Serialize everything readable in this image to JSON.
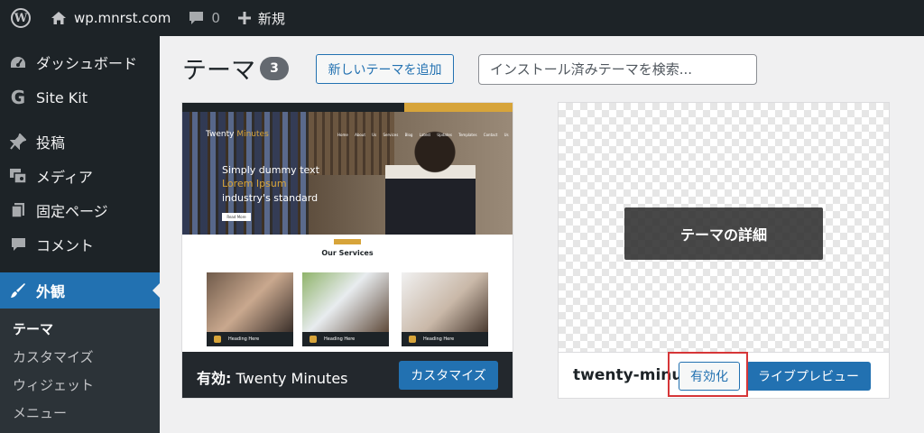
{
  "admin_bar": {
    "site_name": "wp.mnrst.com",
    "comment_count": "0",
    "new_label": "新規",
    "icons": [
      "wordpress-logo-icon",
      "home-icon",
      "comment-icon",
      "plus-icon"
    ]
  },
  "sidebar": {
    "items": [
      {
        "label": "ダッシュボード",
        "icon": "gauge-icon"
      },
      {
        "label": "Site Kit",
        "icon": "google-g-icon"
      },
      {
        "label": "投稿",
        "icon": "pin-icon"
      },
      {
        "label": "メディア",
        "icon": "media-icon"
      },
      {
        "label": "固定ページ",
        "icon": "pages-icon"
      },
      {
        "label": "コメント",
        "icon": "comment-icon"
      },
      {
        "label": "外観",
        "icon": "brush-icon",
        "active": true
      }
    ],
    "submenu": [
      "テーマ",
      "カスタマイズ",
      "ウィジェット",
      "メニュー"
    ]
  },
  "header": {
    "title": "テーマ",
    "count": "3",
    "add_button": "新しいテーマを追加",
    "search_placeholder": "インストール済みテーマを検索..."
  },
  "active_theme": {
    "screenshot": {
      "logo_a": "Twenty ",
      "logo_b": "Minutes",
      "nav": "Home About Us Services Blog Latest Updates Templates Contact Us",
      "line1": "Simply dummy text",
      "line2": "Lorem Ipsum",
      "line3": "industry's standard",
      "button": "Read More",
      "services_title": "Our Services",
      "service_caption": "Heading Here"
    },
    "active_prefix": "有効:",
    "name": "Twenty Minutes",
    "customize_button": "カスタマイズ"
  },
  "other_theme": {
    "details_button": "テーマの詳細",
    "name": "twenty-minutes",
    "activate_button": "有効化",
    "preview_button": "ライブプレビュー"
  },
  "colors": {
    "admin_dark": "#1d2327",
    "accent_blue": "#2271b1",
    "highlight_red": "#d63638"
  }
}
